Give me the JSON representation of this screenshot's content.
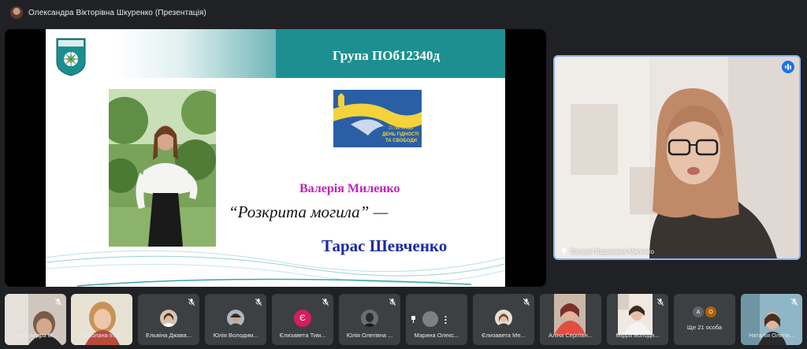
{
  "meeting": {
    "presenter_title": "Олександра Вікторівна Шкуренко (Презентація)"
  },
  "slide": {
    "group": "Група ПОб12340д",
    "flag_text_1": "21 листопада",
    "flag_text_2": "ДЕНЬ ГІДНОСТІ",
    "flag_text_3": "ТА СВОБОДИ",
    "student_name": "Валерія Миленко",
    "poem": "“Розкрита могила” —",
    "author": "Тарас Шевченко"
  },
  "speaker": {
    "name": "Валерія Вадимівна Миленко",
    "icon": "audio-level-icon",
    "accent": "#1a73e8"
  },
  "participants": [
    {
      "label": "Олександра Ві...",
      "type": "video"
    },
    {
      "label": "Роксолана Ігор...",
      "type": "video"
    },
    {
      "label": "Ельвіна Джава...",
      "type": "avatar"
    },
    {
      "label": "Юлія Володим...",
      "type": "avatar"
    },
    {
      "label": "Єлизавета Тим...",
      "type": "initial",
      "initial": "Є",
      "color": "#d81b60"
    },
    {
      "label": "Юлія Олегівна ...",
      "type": "avatar"
    },
    {
      "label": "Марина Олекс...",
      "type": "avatar"
    },
    {
      "label": "Єлизавета Ме...",
      "type": "avatar"
    },
    {
      "label": "Аліна Сергіївн...",
      "type": "video"
    },
    {
      "label": "Мірра Володи...",
      "type": "video"
    },
    {
      "label": "Ще 21 особа",
      "type": "more",
      "initials": [
        "А",
        "О"
      ]
    },
    {
      "label": "Наталія Олегів...",
      "type": "video"
    }
  ]
}
